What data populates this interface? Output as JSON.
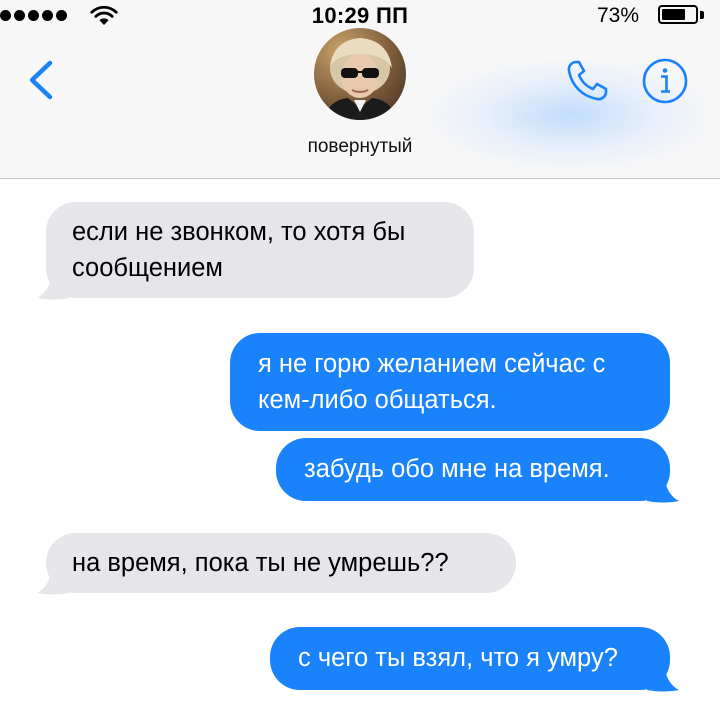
{
  "status_bar": {
    "time": "10:29 ПП",
    "battery_percent": "73%",
    "battery_level": 0.73,
    "signal_bars": 5
  },
  "header": {
    "contact_name": "повернутый",
    "back_icon": "chevron-left-icon",
    "call_icon": "phone-icon",
    "info_icon": "info-icon",
    "accent_color": "#1a82fb"
  },
  "messages": [
    {
      "direction": "received",
      "lines": [
        "если не звонком, то хотя бы",
        "сообщением"
      ]
    },
    {
      "direction": "sent",
      "lines": [
        "я не горю желанием сейчас с",
        "кем-либо общаться."
      ]
    },
    {
      "direction": "sent",
      "lines": [
        "забудь обо мне на время."
      ]
    },
    {
      "direction": "received",
      "lines": [
        "на время, пока ты не умрешь??"
      ]
    },
    {
      "direction": "sent",
      "lines": [
        "с чего ты взял, что я умру?"
      ]
    }
  ],
  "colors": {
    "sent_bubble": "#1a82fb",
    "received_bubble": "#e5e5ea",
    "header_background": "#f7f7f8"
  }
}
